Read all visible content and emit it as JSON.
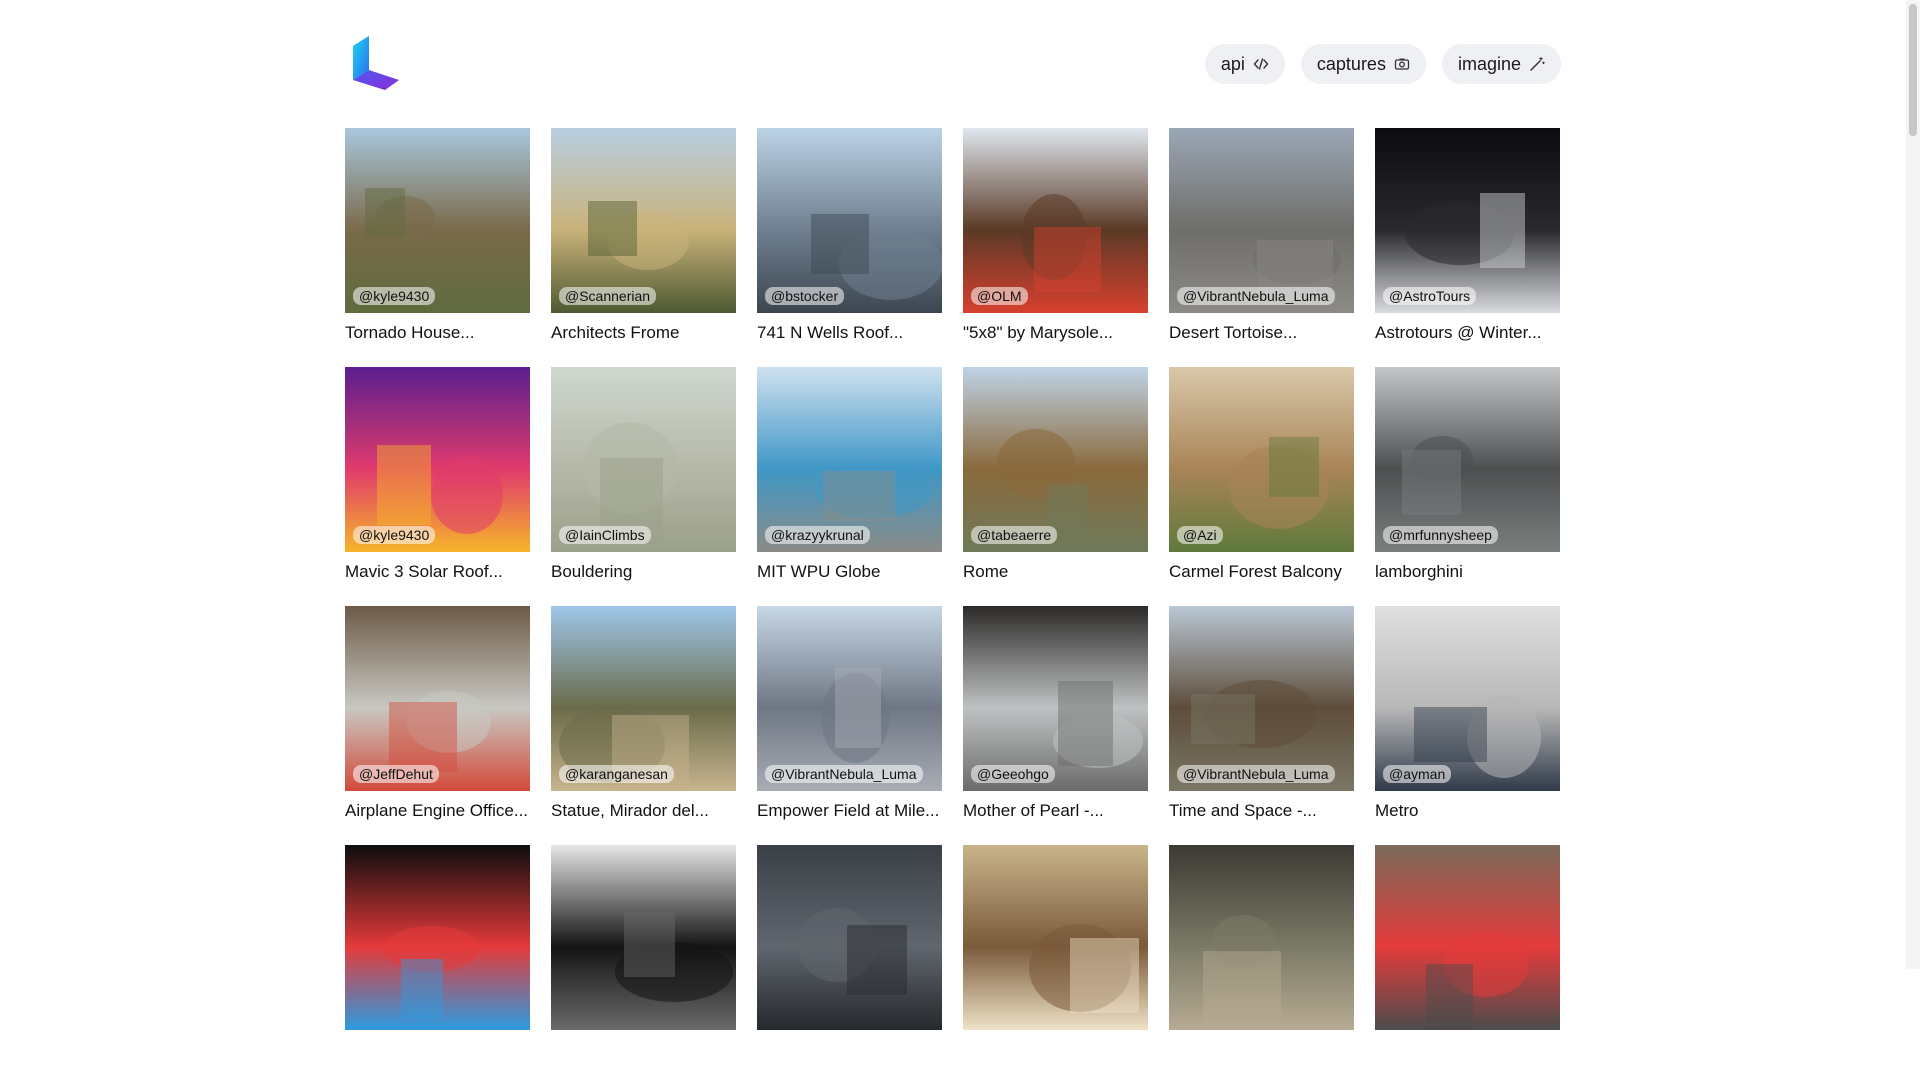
{
  "nav": {
    "api_label": "api",
    "captures_label": "captures",
    "imagine_label": "imagine"
  },
  "captures": [
    {
      "handle": "@kyle9430",
      "title": "Tornado House...",
      "palette": [
        "#a9c7de",
        "#7a6a4a",
        "#5f6b3e"
      ]
    },
    {
      "handle": "@Scannerian",
      "title": "Architects Frome",
      "palette": [
        "#b9cfe3",
        "#c9b27a",
        "#4e5a32"
      ]
    },
    {
      "handle": "@bstocker",
      "title": "741 N Wells Roof...",
      "palette": [
        "#bcd3e6",
        "#6f7f90",
        "#3c4650"
      ]
    },
    {
      "handle": "@OLM",
      "title": "\"5x8\" by Marysole...",
      "palette": [
        "#dfe7ef",
        "#5b3a26",
        "#d7402f"
      ]
    },
    {
      "handle": "@VibrantNebula_Luma",
      "title": "Desert Tortoise...",
      "palette": [
        "#9aa7b6",
        "#6f6e6a",
        "#8c8a84"
      ]
    },
    {
      "handle": "@AstroTours",
      "title": "Astrotours @ Winter...",
      "palette": [
        "#0b0b10",
        "#2a2a2e",
        "#d9dbe0"
      ]
    },
    {
      "handle": "@kyle9430",
      "title": "Mavic 3 Solar Roof...",
      "palette": [
        "#5a1f8f",
        "#e03a6c",
        "#f6b52a"
      ]
    },
    {
      "handle": "@IainClimbs",
      "title": "Bouldering",
      "palette": [
        "#cfd8cf",
        "#b5b8a8",
        "#9aa08a"
      ]
    },
    {
      "handle": "@krazyykrunal",
      "title": "MIT WPU Globe",
      "palette": [
        "#cfe1f0",
        "#3f97c6",
        "#8a8b86"
      ]
    },
    {
      "handle": "@tabeaerre",
      "title": "Rome",
      "palette": [
        "#bfd3e6",
        "#8a6a3d",
        "#6f7a5a"
      ]
    },
    {
      "handle": "@Azi",
      "title": "Carmel Forest Balcony",
      "palette": [
        "#d9c8a9",
        "#a98457",
        "#5f7a3c"
      ]
    },
    {
      "handle": "@mrfunnysheep",
      "title": "lamborghini",
      "palette": [
        "#c4c7c9",
        "#4d4f50",
        "#7a7f7e"
      ]
    },
    {
      "handle": "@JeffDehut",
      "title": "Airplane Engine Office...",
      "palette": [
        "#6c5a47",
        "#c8c8c2",
        "#d24a3a"
      ]
    },
    {
      "handle": "@karanganesan",
      "title": "Statue, Mirador del...",
      "palette": [
        "#9fc6ea",
        "#6b6b4a",
        "#c7b48e"
      ]
    },
    {
      "handle": "@VibrantNebula_Luma",
      "title": "Empower Field at Mile...",
      "palette": [
        "#c7d7e6",
        "#6e7784",
        "#a8adb5"
      ]
    },
    {
      "handle": "@Geeohgo",
      "title": "Mother of Pearl -...",
      "palette": [
        "#2c2a28",
        "#bfc2c3",
        "#6a6a6a"
      ]
    },
    {
      "handle": "@VibrantNebula_Luma",
      "title": "Time and Space -...",
      "palette": [
        "#b9c7d5",
        "#5e4d3a",
        "#7b7766"
      ]
    },
    {
      "handle": "@ayman",
      "title": "Metro",
      "palette": [
        "#e0e0e0",
        "#b7b7b7",
        "#2f3a4a"
      ]
    },
    {
      "handle": "",
      "title": "",
      "palette": [
        "#0d0d0d",
        "#e43a3a",
        "#2d9be0"
      ]
    },
    {
      "handle": "",
      "title": "",
      "palette": [
        "#e6e6e6",
        "#141414",
        "#6a6a6a"
      ]
    },
    {
      "handle": "",
      "title": "",
      "palette": [
        "#3b4047",
        "#60666e",
        "#25282c"
      ]
    },
    {
      "handle": "",
      "title": "",
      "palette": [
        "#c9b48c",
        "#7a5a3a",
        "#efe2c7"
      ]
    },
    {
      "handle": "",
      "title": "",
      "palette": [
        "#3c3a33",
        "#7b7a66",
        "#b7aa92"
      ]
    },
    {
      "handle": "",
      "title": "",
      "palette": [
        "#7a6a58",
        "#e33b3b",
        "#4c4c4c"
      ]
    }
  ]
}
